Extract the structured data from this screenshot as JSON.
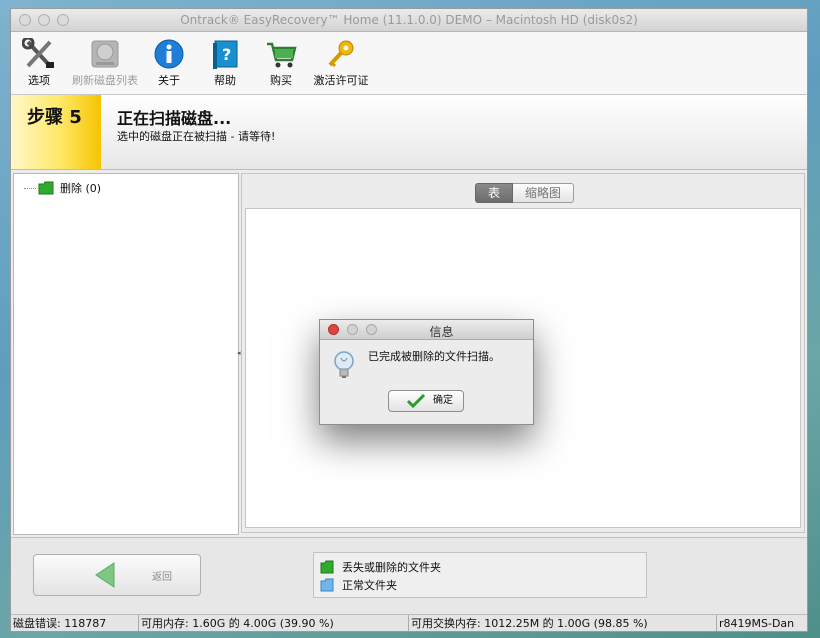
{
  "window": {
    "title": "Ontrack® EasyRecovery™ Home (11.1.0.0) DEMO – Macintosh HD (disk0s2)"
  },
  "toolbar": {
    "options": "选项",
    "refresh": "刷新磁盘列表",
    "about": "关于",
    "help": "帮助",
    "buy": "购买",
    "activate": "激活许可证"
  },
  "step": {
    "label": "步骤 5",
    "heading": "正在扫描磁盘...",
    "subheading": "选中的磁盘正在被扫描 - 请等待!"
  },
  "tree": {
    "item": "删除 (0)"
  },
  "tabs": {
    "table": "表",
    "thumbnail": "缩略图"
  },
  "dialog": {
    "title": "信息",
    "message": "已完成被删除的文件扫描。",
    "ok": "确定"
  },
  "bottom": {
    "back": "返回",
    "legend_lost": "丢失或删除的文件夹",
    "legend_normal": "正常文件夹"
  },
  "status": {
    "disk_errors": "磁盘错误: 118787",
    "memory": "可用内存: 1.60G 的 4.00G (39.90 %)",
    "swap": "可用交换内存: 1012.25M 的 1.00G (98.85 %)",
    "machine": "r8419MS-Dan"
  },
  "colors": {
    "step_yellow": "#ffe866",
    "folder_green": "#2faa2f",
    "folder_blue": "#6fb6ea",
    "close_red": "#e0443e"
  }
}
